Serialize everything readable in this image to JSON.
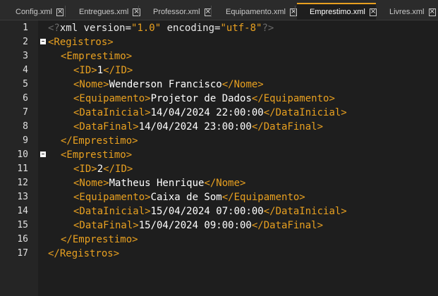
{
  "tabs": [
    {
      "label": "Config.xml",
      "close": "x"
    },
    {
      "label": "Entregues.xml",
      "close": "x"
    },
    {
      "label": "Professor.xml",
      "close": "x"
    },
    {
      "label": "Equipamento.xml",
      "close": "x"
    },
    {
      "label": "Emprestimo.xml",
      "close": "x"
    },
    {
      "label": "Livres.xml",
      "close": "x"
    }
  ],
  "line_numbers": [
    "1",
    "2",
    "3",
    "4",
    "5",
    "6",
    "7",
    "8",
    "9",
    "10",
    "11",
    "12",
    "13",
    "14",
    "15",
    "16",
    "17"
  ],
  "code": {
    "l1": {
      "open": "<?",
      "name": "xml",
      "attr1": " version=",
      "val1": "\"1.0\"",
      "attr2": " encoding=",
      "val2": "\"utf-8\"",
      "close": "?>"
    },
    "l2": {
      "tag": "<Registros>"
    },
    "l3": {
      "tag": "<Emprestimo>"
    },
    "l4": {
      "open": "<ID>",
      "text": "1",
      "close": "</ID>"
    },
    "l5": {
      "open": "<Nome>",
      "text": "Wenderson Francisco",
      "close": "</Nome>"
    },
    "l6": {
      "open": "<Equipamento>",
      "text": "Projetor de Dados",
      "close": "</Equipamento>"
    },
    "l7": {
      "open": "<DataInicial>",
      "text": "14/04/2024 22:00:00",
      "close": "</DataInicial>"
    },
    "l8": {
      "open": "<DataFinal>",
      "text": "14/04/2024 23:00:00",
      "close": "</DataFinal>"
    },
    "l9": {
      "tag": "</Emprestimo>"
    },
    "l10": {
      "tag": "<Emprestimo>"
    },
    "l11": {
      "open": "<ID>",
      "text": "2",
      "close": "</ID>"
    },
    "l12": {
      "open": "<Nome>",
      "text": "Matheus Henrique",
      "close": "</Nome>"
    },
    "l13": {
      "open": "<Equipamento>",
      "text": "Caixa de Som",
      "close": "</Equipamento>"
    },
    "l14": {
      "open": "<DataInicial>",
      "text": "15/04/2024 07:00:00",
      "close": "</DataInicial>"
    },
    "l15": {
      "open": "<DataFinal>",
      "text": "15/04/2024 09:00:00",
      "close": "</DataFinal>"
    },
    "l16": {
      "tag": "</Emprestimo>"
    },
    "l17": {
      "tag": "</Registros>"
    }
  },
  "colors": {
    "tag": "#e8a020",
    "background": "#1e1e1e",
    "gutter": "#252525",
    "active_tab_accent": "#e8a020"
  }
}
